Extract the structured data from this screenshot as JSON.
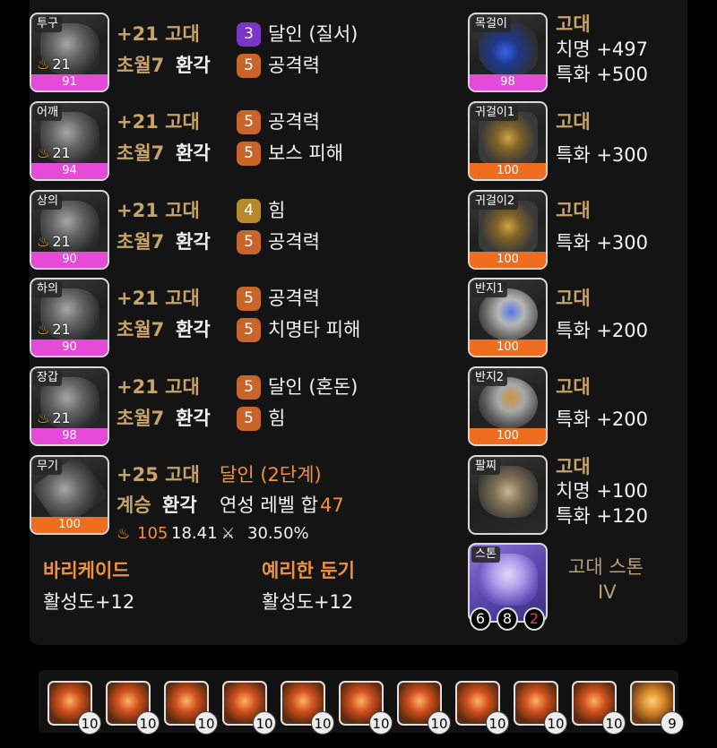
{
  "armor": [
    {
      "slot": "투구",
      "level": "21",
      "quality": "91",
      "quality_color": "pink",
      "honing": "+21 고대",
      "transcend": "초월7",
      "elixir": "환각",
      "eng1": {
        "count": "3",
        "name": "달인 (질서)",
        "color": "purple"
      },
      "eng2": {
        "count": "5",
        "name": "공격력",
        "color": "orange"
      }
    },
    {
      "slot": "어깨",
      "level": "21",
      "quality": "94",
      "quality_color": "pink",
      "honing": "+21 고대",
      "transcend": "초월7",
      "elixir": "환각",
      "eng1": {
        "count": "5",
        "name": "공격력",
        "color": "orange"
      },
      "eng2": {
        "count": "5",
        "name": "보스 피해",
        "color": "orange"
      }
    },
    {
      "slot": "상의",
      "level": "21",
      "quality": "90",
      "quality_color": "pink",
      "honing": "+21 고대",
      "transcend": "초월7",
      "elixir": "환각",
      "eng1": {
        "count": "4",
        "name": "힘",
        "color": "gold"
      },
      "eng2": {
        "count": "5",
        "name": "공격력",
        "color": "orange"
      }
    },
    {
      "slot": "하의",
      "level": "21",
      "quality": "90",
      "quality_color": "pink",
      "honing": "+21 고대",
      "transcend": "초월7",
      "elixir": "환각",
      "eng1": {
        "count": "5",
        "name": "공격력",
        "color": "orange"
      },
      "eng2": {
        "count": "5",
        "name": "치명타 피해",
        "color": "orange"
      }
    },
    {
      "slot": "장갑",
      "level": "21",
      "quality": "98",
      "quality_color": "pink",
      "honing": "+21 고대",
      "transcend": "초월7",
      "elixir": "환각",
      "eng1": {
        "count": "5",
        "name": "달인 (혼돈)",
        "color": "orange"
      },
      "eng2": {
        "count": "5",
        "name": "힘",
        "color": "orange"
      }
    }
  ],
  "weapon": {
    "slot": "무기",
    "quality": "100",
    "honing": "+25 고대",
    "effect": "달인 (2단계)",
    "succession": "계승",
    "elixir": "환각",
    "elixir_sum_label": "연성 레벨 합",
    "elixir_sum_value": "47",
    "transcend_value": "105",
    "stat_a": "18.41",
    "stat_b": "30.50%"
  },
  "bracelet_effects": [
    {
      "name": "바리케이드",
      "value": "활성도+12"
    },
    {
      "name": "예리한 둔기",
      "value": "활성도+12"
    }
  ],
  "accessories": [
    {
      "slot": "목걸이",
      "quality": "98",
      "quality_color": "pink",
      "grade": "고대",
      "lines": [
        "치명 +497",
        "특화 +500"
      ],
      "kind": "neck"
    },
    {
      "slot": "귀걸이1",
      "quality": "100",
      "quality_color": "orange",
      "grade": "고대",
      "lines": [
        "특화 +300"
      ],
      "kind": "acc"
    },
    {
      "slot": "귀걸이2",
      "quality": "100",
      "quality_color": "orange",
      "grade": "고대",
      "lines": [
        "특화 +300"
      ],
      "kind": "acc"
    },
    {
      "slot": "반지1",
      "quality": "100",
      "quality_color": "orange",
      "grade": "고대",
      "lines": [
        "특화 +200"
      ],
      "kind": "ring1"
    },
    {
      "slot": "반지2",
      "quality": "100",
      "quality_color": "orange",
      "grade": "고대",
      "lines": [
        "특화 +200"
      ],
      "kind": "ring2"
    },
    {
      "slot": "팔찌",
      "grade": "고대",
      "lines": [
        "치명 +100",
        "특화 +120"
      ],
      "kind": "brace"
    }
  ],
  "stone": {
    "slot": "스톤",
    "name": "고대 스톤",
    "tier": "IV",
    "values": [
      "6",
      "8",
      "2"
    ]
  },
  "gems": [
    "10",
    "10",
    "10",
    "10",
    "10",
    "10",
    "10",
    "10",
    "10",
    "10",
    "9"
  ],
  "colors": {
    "pink": "#e54bd8",
    "orange": "#ee6d1f",
    "purple": "#7a35c8",
    "gold_text": "#c7a36a",
    "accent_orange": "#f0923a"
  }
}
